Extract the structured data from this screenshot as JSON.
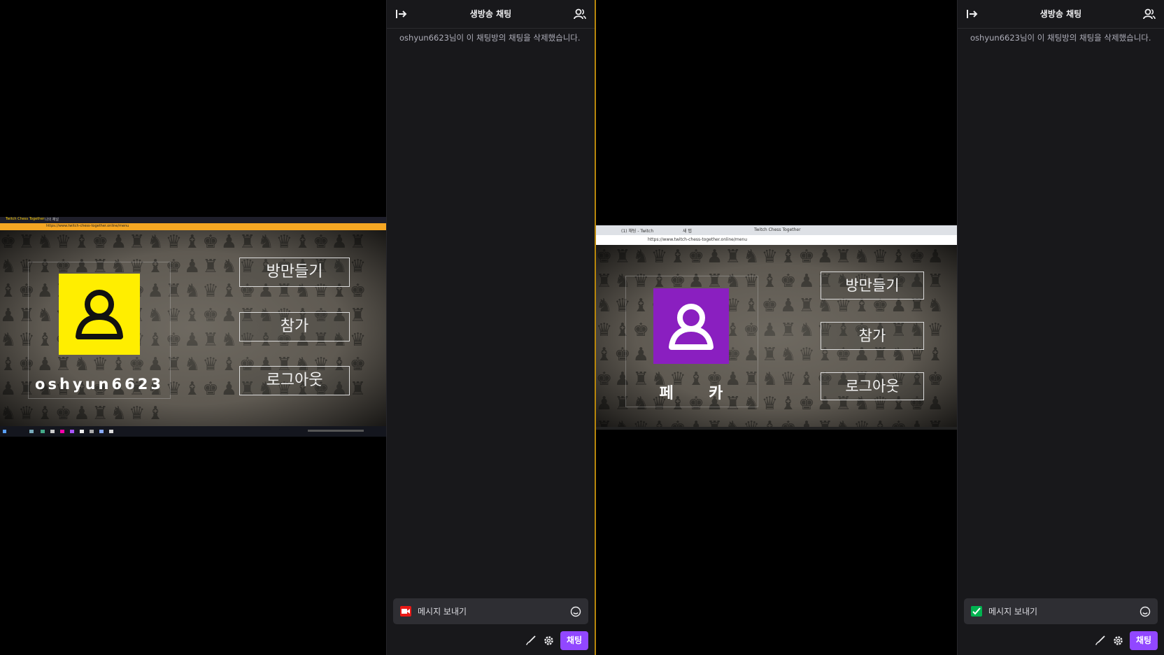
{
  "left_stream": {
    "browser": {
      "tabs": [
        "Twitch Chess Together",
        "나의 채널"
      ],
      "url": "https://www.twitch-chess-together.online/menu"
    },
    "player_name": "oshyun6623",
    "avatar_color": "#ffee00",
    "buttons": {
      "create_room": "방만들기",
      "join": "참가",
      "logout": "로그아웃"
    }
  },
  "right_stream": {
    "browser": {
      "tabs": [
        "(1) 채팅 - Twitch",
        "새 탭",
        "Twitch Chess Together"
      ],
      "url": "https://www.twitch-chess-together.online/menu"
    },
    "player_name": "페     카",
    "avatar_color": "#8a1fc0",
    "buttons": {
      "create_room": "방만들기",
      "join": "참가",
      "logout": "로그아웃"
    }
  },
  "chat_left": {
    "title": "생방송 채팅",
    "message": "oshyun6623님이 이 채팅방의 채팅을 삭제했습니다.",
    "input_placeholder": "메시지 보내기",
    "badge_color": "#e91916",
    "send_button": "채팅"
  },
  "chat_right": {
    "title": "생방송 채팅",
    "message": "oshyun6623님이 이 채팅방의 채팅을 삭제했습니다.",
    "input_placeholder": "메시지 보내기",
    "badge_color": "#00b350",
    "send_button": "채팅"
  },
  "colors": {
    "accent": "#9147ff",
    "divider": "#b8860b"
  }
}
